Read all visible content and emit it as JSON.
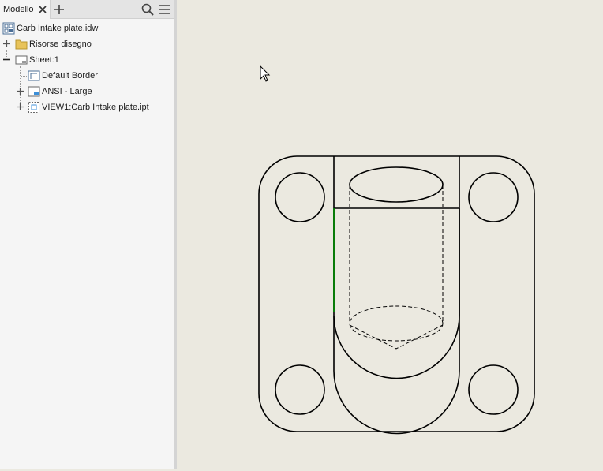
{
  "browser": {
    "tab_label": "Modello",
    "tree": {
      "document": "Carb Intake plate.idw",
      "resources": "Risorse disegno",
      "sheet": "Sheet:1",
      "border": "Default Border",
      "title_block": "ANSI - Large",
      "view": "VIEW1:Carb Intake plate.ipt"
    }
  },
  "icons": {
    "close_tab": "close-icon",
    "add_tab": "plus-icon",
    "search": "search-icon",
    "menu": "hamburger-menu-icon"
  },
  "colors": {
    "canvas_background": "#ebe9e0",
    "highlight_edge": "#008000",
    "folder": "#e8c35a"
  }
}
